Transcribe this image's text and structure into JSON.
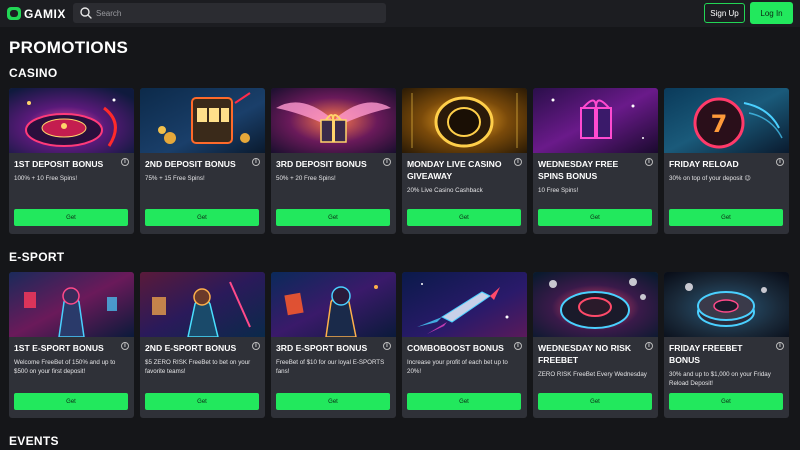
{
  "header": {
    "logo_text": "GAMIX",
    "search_placeholder": "Search",
    "signup_label": "Sign Up",
    "login_label": "Log In"
  },
  "page_title": "PROMOTIONS",
  "sections": {
    "casino": {
      "title": "CASINO",
      "cards": [
        {
          "title": "1ST DEPOSIT BONUS",
          "desc": "100% + 10 Free Spins!",
          "button": "Get"
        },
        {
          "title": "2ND DEPOSIT BONUS",
          "desc": "75% + 15 Free Spins!",
          "button": "Get"
        },
        {
          "title": "3RD DEPOSIT BONUS",
          "desc": "50% + 20 Free Spins!",
          "button": "Get"
        },
        {
          "title": "MONDAY LIVE CASINO GIVEAWAY",
          "desc": "20% Live Casino Cashback",
          "button": "Get"
        },
        {
          "title": "WEDNESDAY FREE SPINS BONUS",
          "desc": "10 Free Spins!",
          "button": "Get"
        },
        {
          "title": "FRIDAY RELOAD",
          "desc": "30% on top of your deposit 😉",
          "button": "Get"
        }
      ]
    },
    "esport": {
      "title": "E-SPORT",
      "cards": [
        {
          "title": "1ST E-SPORT BONUS",
          "desc": "Welcome FreeBet of 150% and up to $500 on your first deposit!",
          "button": "Get"
        },
        {
          "title": "2ND E-SPORT BONUS",
          "desc": "$5 ZERO RISK FreeBet to bet on your favorite teams!",
          "button": "Get"
        },
        {
          "title": "3RD E-SPORT BONUS",
          "desc": "FreeBet of $10 for our loyal E-SPORTS fans!",
          "button": "Get"
        },
        {
          "title": "COMBOBOOST BONUS",
          "desc": "Increase your profit of each bet up to 20%!",
          "button": "Get"
        },
        {
          "title": "WEDNESDAY NO RISK FREEBET",
          "desc": "ZERO RISK FreeBet Every Wednesday",
          "button": "Get"
        },
        {
          "title": "FRIDAY FREEBET BONUS",
          "desc": "30% and up to $1,000 on your Friday Reload Deposit!",
          "button": "Get"
        }
      ]
    },
    "events": {
      "title": "EVENTS"
    }
  },
  "icons": {
    "info": "i"
  },
  "colors": {
    "accent": "#22e85d",
    "background": "#151619",
    "card": "#2f3138",
    "header": "#1c1d21"
  }
}
